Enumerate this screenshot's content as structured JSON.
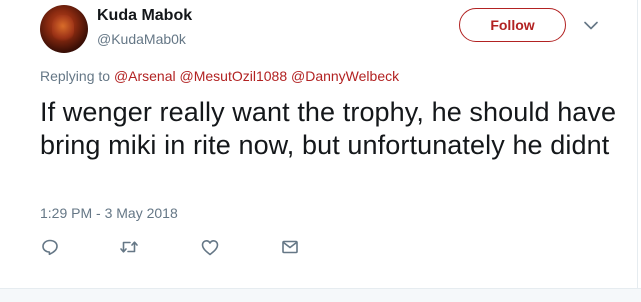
{
  "user": {
    "display_name": "Kuda Mabok",
    "screen_name": "@KudaMab0k"
  },
  "follow_label": "Follow",
  "reply_context": {
    "prefix": "Replying to",
    "mentions": [
      "@Arsenal",
      "@MesutOzil1088",
      "@DannyWelbeck"
    ]
  },
  "tweet": {
    "text": "If wenger really want the trophy, he should have bring miki in rite now, but unfortunately he didnt",
    "timestamp": "1:29 PM - 3 May 2018"
  },
  "icons": {
    "menu": "chevron-down-icon",
    "reply": "reply-icon",
    "retweet": "retweet-icon",
    "like": "heart-icon",
    "message": "envelope-icon",
    "avatar": "avatar"
  },
  "colors": {
    "accent": "#b22222",
    "text": "#14171a",
    "secondary": "#657786",
    "icon": "#657786"
  }
}
